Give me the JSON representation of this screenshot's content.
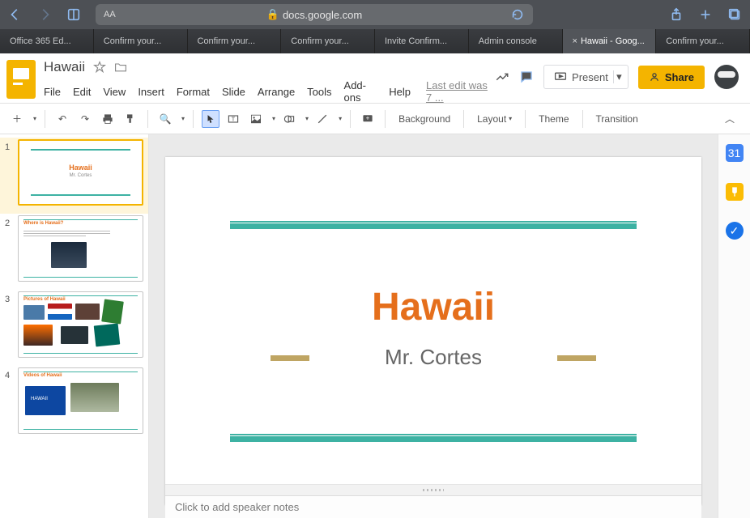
{
  "safari": {
    "url_display": "docs.google.com",
    "tabs": [
      {
        "label": "Office 365 Ed...",
        "active": false
      },
      {
        "label": "Confirm your...",
        "active": false
      },
      {
        "label": "Confirm your...",
        "active": false
      },
      {
        "label": "Confirm your...",
        "active": false
      },
      {
        "label": "Invite Confirm...",
        "active": false
      },
      {
        "label": "Admin console",
        "active": false
      },
      {
        "label": "Hawaii - Goog...",
        "active": true
      },
      {
        "label": "Confirm your...",
        "active": false
      }
    ]
  },
  "doc": {
    "title": "Hawaii",
    "menus": [
      "File",
      "Edit",
      "View",
      "Insert",
      "Format",
      "Slide",
      "Arrange",
      "Tools",
      "Add-ons",
      "Help"
    ],
    "last_edit": "Last edit was 7 ...",
    "present_label": "Present",
    "share_label": "Share"
  },
  "toolbar": {
    "background": "Background",
    "layout": "Layout",
    "theme": "Theme",
    "transition": "Transition"
  },
  "slides": {
    "thumbs": [
      {
        "num": "1",
        "title": "Hawaii",
        "sub": "Mr. Cortes",
        "type": "title",
        "selected": true
      },
      {
        "num": "2",
        "heading": "Where is Hawaii?",
        "type": "text-img"
      },
      {
        "num": "3",
        "heading": "Pictures of Hawaii",
        "type": "pics"
      },
      {
        "num": "4",
        "heading": "Videos of Hawaii",
        "type": "videos"
      }
    ]
  },
  "current_slide": {
    "title": "Hawaii",
    "subtitle": "Mr. Cortes"
  },
  "notes_placeholder": "Click to add speaker notes"
}
